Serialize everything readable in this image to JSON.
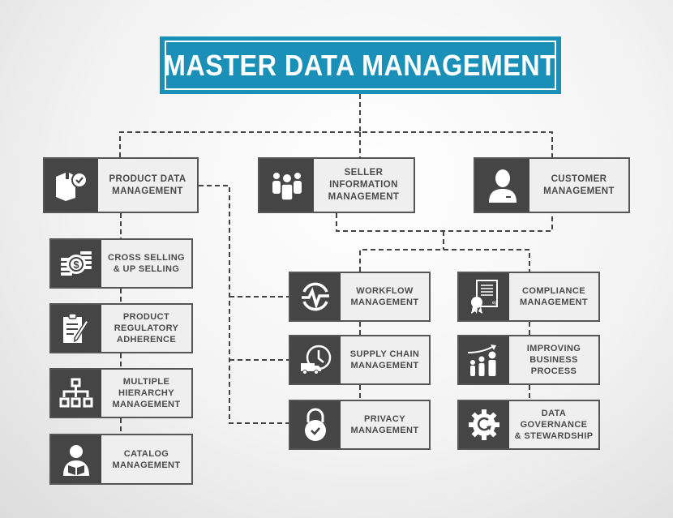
{
  "title": "MASTER DATA MANAGEMENT",
  "colors": {
    "accent": "#1a90b9",
    "icon_panel": "#454545",
    "label_bg": "#efefef",
    "text": "#4a4a4a",
    "connector": "#444444"
  },
  "top_nodes": [
    {
      "label": "PRODUCT DATA\nMANAGEMENT",
      "icon": "box-check-icon"
    },
    {
      "label": "SELLER\nINFORMATION\nMANAGEMENT",
      "icon": "team-icon"
    },
    {
      "label": "CUSTOMER\nMANAGEMENT",
      "icon": "customer-icon"
    }
  ],
  "product_children": [
    {
      "label": "CROSS SELLING\n& UP SELLING",
      "icon": "coins-dollar-icon"
    },
    {
      "label": "PRODUCT\nREGULATORY\nADHERENCE",
      "icon": "clipboard-pen-icon"
    },
    {
      "label": "MULTIPLE\nHIERARCHY\nMANAGEMENT",
      "icon": "hierarchy-icon"
    },
    {
      "label": "CATALOG\nMANAGEMENT",
      "icon": "reader-icon"
    }
  ],
  "middle_children": [
    {
      "label": "WORKFLOW\nMANAGEMENT",
      "icon": "workflow-pulse-icon"
    },
    {
      "label": "SUPPLY CHAIN\nMANAGEMENT",
      "icon": "delivery-clock-icon"
    },
    {
      "label": "PRIVACY\nMANAGEMENT",
      "icon": "padlock-check-icon"
    }
  ],
  "right_children": [
    {
      "label": "COMPLIANCE\nMANAGEMENT",
      "icon": "certificate-icon"
    },
    {
      "label": "IMPROVING\nBUSINESS\nPROCESS",
      "icon": "growth-people-icon"
    },
    {
      "label": "DATA\nGOVERNANCE\n& STEWARDSHIP",
      "icon": "gear-cycle-icon"
    }
  ]
}
